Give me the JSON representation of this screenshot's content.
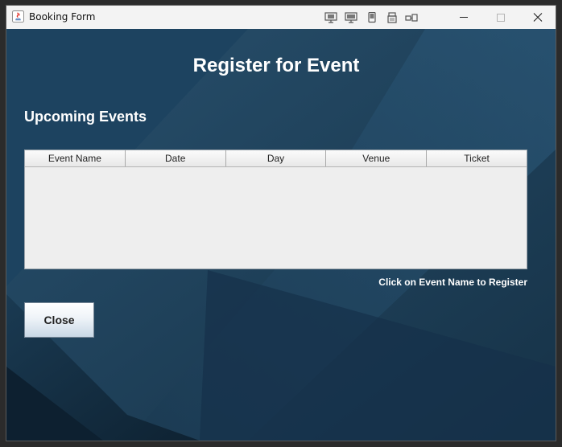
{
  "window": {
    "title": "Booking Form",
    "toolbar_icons": [
      "monitor-icon",
      "monitor-icon",
      "tablet-icon",
      "printer-icon",
      "share-icon"
    ],
    "controls": [
      "minimize",
      "maximize",
      "close"
    ]
  },
  "main": {
    "heading": "Register for Event",
    "subheading": "Upcoming Events",
    "table": {
      "columns": [
        "Event Name",
        "Date",
        "Day",
        "Venue",
        "Ticket"
      ],
      "rows": []
    },
    "hint": "Click on Event Name to Register",
    "close_label": "Close"
  },
  "colors": {
    "background": "#1f4460",
    "text": "#ffffff"
  }
}
